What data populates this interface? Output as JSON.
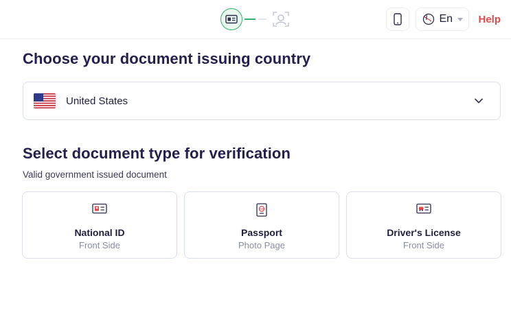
{
  "header": {
    "steps": [
      {
        "icon": "id-card-icon",
        "state": "active"
      },
      {
        "icon": "face-scan-icon",
        "state": "pending"
      }
    ],
    "language": "En",
    "help_label": "Help",
    "colors": {
      "accent_green": "#2fb36a",
      "help_red": "#e04a4a"
    }
  },
  "country_section": {
    "title": "Choose your document issuing country",
    "selected_country": "United States",
    "flag_icon": "us-flag-icon"
  },
  "document_section": {
    "title": "Select document type for verification",
    "subtitle": "Valid government issued document",
    "cards": [
      {
        "icon": "national-id-icon",
        "title": "National ID",
        "subtitle": "Front Side"
      },
      {
        "icon": "passport-icon",
        "title": "Passport",
        "subtitle": "Photo Page"
      },
      {
        "icon": "drivers-license-icon",
        "title": "Driver's License",
        "subtitle": "Front Side"
      }
    ]
  }
}
